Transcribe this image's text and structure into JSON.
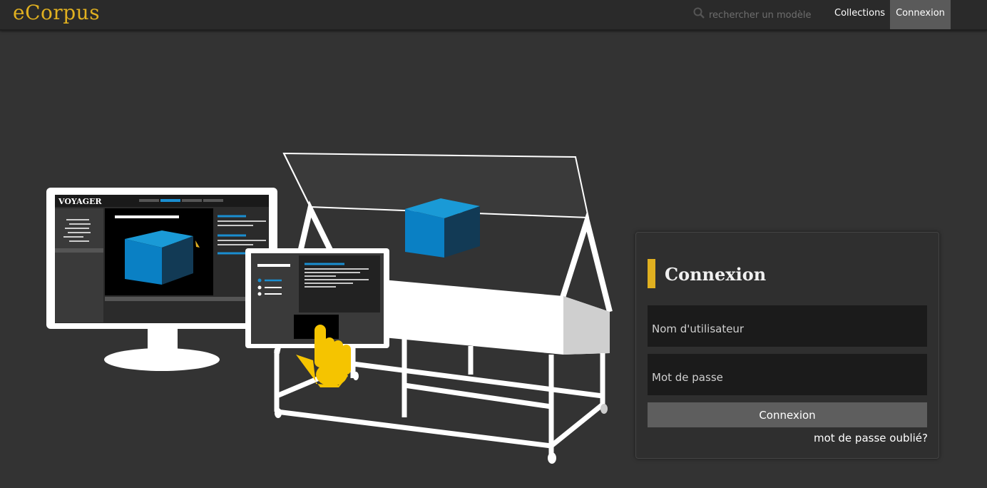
{
  "header": {
    "logo": "eCorpus",
    "search_placeholder": "rechercher un modèle",
    "nav": {
      "collections": "Collections",
      "login": "Connexion"
    }
  },
  "illustration": {
    "monitor_brand": "VOYAGER",
    "icons": [
      "monitor-icon",
      "kiosk-showcase-icon",
      "tablet-icon",
      "hand-pointer-icon",
      "cube-icon"
    ]
  },
  "login": {
    "title": "Connexion",
    "username_placeholder": "Nom d'utilisateur",
    "password_placeholder": "Mot de passe",
    "submit_label": "Connexion",
    "forgot_label": "mot de passe oublié?"
  },
  "colors": {
    "accent": "#e0b020",
    "background": "#333333",
    "topbar": "#2a2a2a",
    "cube_blue": "#0a80c4"
  }
}
